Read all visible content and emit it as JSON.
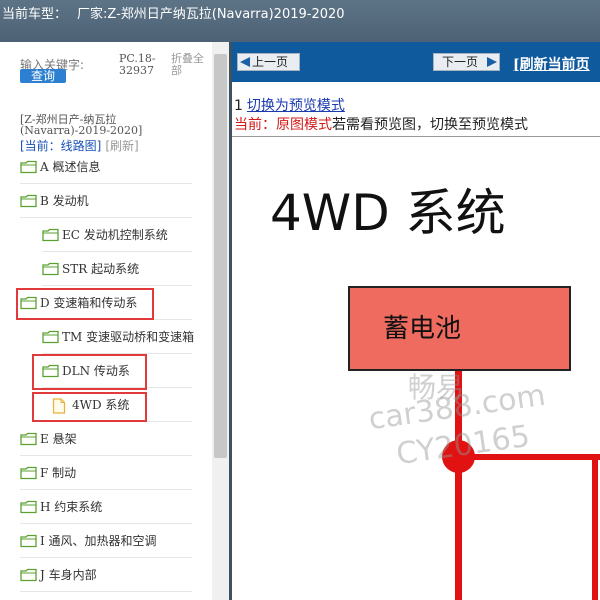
{
  "window": {
    "vehicle_label": "当前车型：",
    "maker_title": "厂家:Z-郑州日产纳瓦拉(Navarra)2019-2020"
  },
  "left": {
    "keyword_label": "输入关键字:",
    "search_button": "查询",
    "pc_code": "PC.18-32937",
    "collapse_all": "折叠全部",
    "maker_tree_title": "[Z-郑州日产-纳瓦拉(Navarra)-2019-2020]",
    "current_label": "[当前：线路图]",
    "refresh_label": "[刷新]",
    "tree": [
      {
        "label": "A 概述信息",
        "icon": "folder-icon"
      },
      {
        "label": "B 发动机",
        "icon": "folder-icon"
      },
      {
        "label": "EC 发动机控制系统",
        "icon": "folder-icon"
      },
      {
        "label": "STR 起动系统",
        "icon": "folder-icon"
      },
      {
        "label": "D 变速箱和传动系",
        "icon": "folder-icon"
      },
      {
        "label": "TM 变速驱动桥和变速箱",
        "icon": "folder-icon"
      },
      {
        "label": "DLN 传动系",
        "icon": "folder-icon"
      },
      {
        "label": "4WD 系统",
        "icon": "file-icon"
      },
      {
        "label": "E 悬架",
        "icon": "folder-icon"
      },
      {
        "label": "F 制动",
        "icon": "folder-icon"
      },
      {
        "label": "H 约束系统",
        "icon": "folder-icon"
      },
      {
        "label": "I 通风、加热器和空调",
        "icon": "folder-icon"
      },
      {
        "label": "J 车身内部",
        "icon": "folder-icon"
      }
    ]
  },
  "right": {
    "prev_button": "上一页",
    "next_button": "下一页",
    "refresh_page": "[刷新当前页",
    "mode_number": "1",
    "switch_link": "切换为预览模式",
    "current_prefix": "当前：",
    "current_mode": "原图模式",
    "current_hint": "若需看预览图，切换至预览模式",
    "diagram_title": "4WD 系统",
    "battery_label": "蓄电池"
  },
  "watermark": {
    "line1": "畅易",
    "line2": "car388.com",
    "line3": "CY20165"
  },
  "colors": {
    "titlebar": "#4d6275",
    "navbar": "#0f5a9d",
    "highlight": "#e23a3a",
    "battery": "#ef6b5f",
    "wire": "#e01212"
  }
}
